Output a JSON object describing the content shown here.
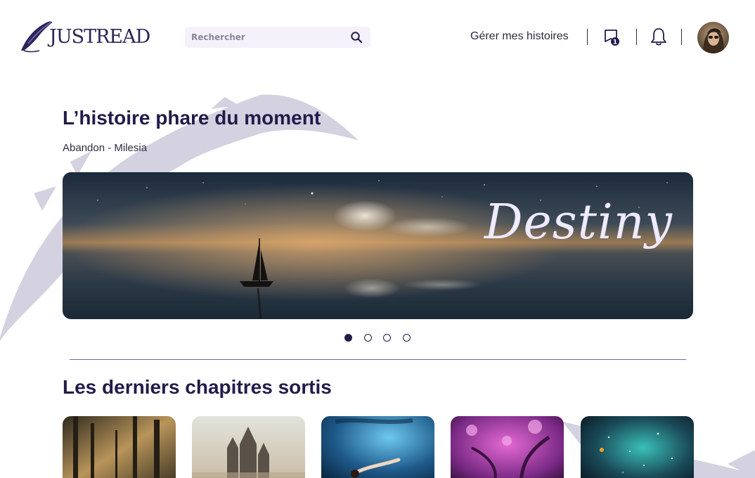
{
  "header": {
    "logo_text": "JUSTREAD",
    "search_placeholder": "Rechercher",
    "manage_link": "Gérer mes histoires",
    "library_badge": "1"
  },
  "hero": {
    "title": "L’histoire phare du moment",
    "subtitle": "Abandon - Milesia",
    "banner_title": "Destiny",
    "carousel_total": 4,
    "carousel_active": 1
  },
  "latest": {
    "title": "Les derniers chapitres sortis"
  },
  "colors": {
    "primary": "#211c4a",
    "feather": "#d4d1e0",
    "search_bg": "#f5f1fb",
    "divider": "#6f6b9c"
  }
}
